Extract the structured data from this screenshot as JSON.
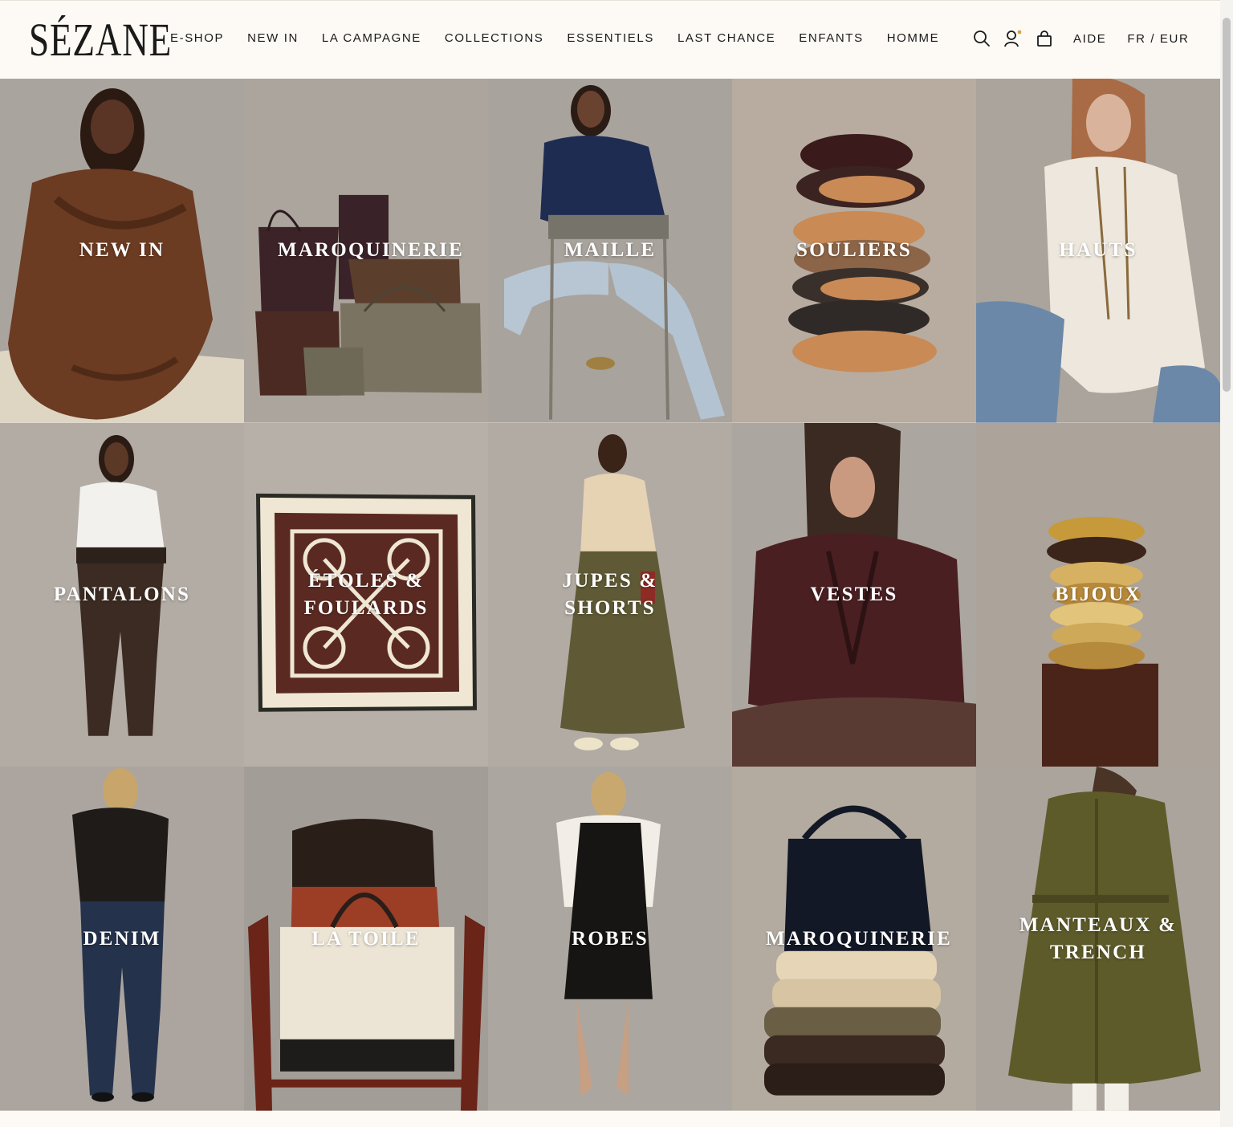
{
  "brand": {
    "logo": "SÉZANE"
  },
  "nav": {
    "items": [
      {
        "label": "E-SHOP"
      },
      {
        "label": "NEW IN"
      },
      {
        "label": "LA CAMPAGNE"
      },
      {
        "label": "COLLECTIONS"
      },
      {
        "label": "ESSENTIELS"
      },
      {
        "label": "LAST CHANCE"
      },
      {
        "label": "ENFANTS"
      },
      {
        "label": "HOMME"
      }
    ]
  },
  "tools": {
    "icons": [
      "search-icon",
      "account-icon",
      "bag-icon"
    ],
    "help_label": "AIDE",
    "locale_label": "FR / EUR",
    "account_dot_color": "#d9a441"
  },
  "tiles": [
    {
      "label": "NEW IN",
      "subject": "woman-brown-knit"
    },
    {
      "label": "MAROQUINERIE",
      "subject": "stacked-leather-bags"
    },
    {
      "label": "MAILLE",
      "subject": "woman-navy-sweater-chair"
    },
    {
      "label": "SOULIERS",
      "subject": "stacked-mules"
    },
    {
      "label": "HAUTS",
      "subject": "woman-white-blouse"
    },
    {
      "label": "PANTALONS",
      "subject": "woman-leather-trousers"
    },
    {
      "label": "ÉTOLES & FOULARDS",
      "subject": "patterned-silk-scarf"
    },
    {
      "label": "JUPES & SHORTS",
      "subject": "woman-olive-skirt"
    },
    {
      "label": "VESTES",
      "subject": "woman-leather-jacket"
    },
    {
      "label": "BIJOUX",
      "subject": "stacked-gold-bangles"
    },
    {
      "label": "DENIM",
      "subject": "woman-dark-jeans"
    },
    {
      "label": "LA TOILE",
      "subject": "canvas-tote-on-chair"
    },
    {
      "label": "ROBES",
      "subject": "woman-black-dress"
    },
    {
      "label": "MAROQUINERIE",
      "subject": "navy-bag-on-cushions"
    },
    {
      "label": "MANTEAUX & TRENCH",
      "subject": "khaki-trench-coat"
    }
  ]
}
